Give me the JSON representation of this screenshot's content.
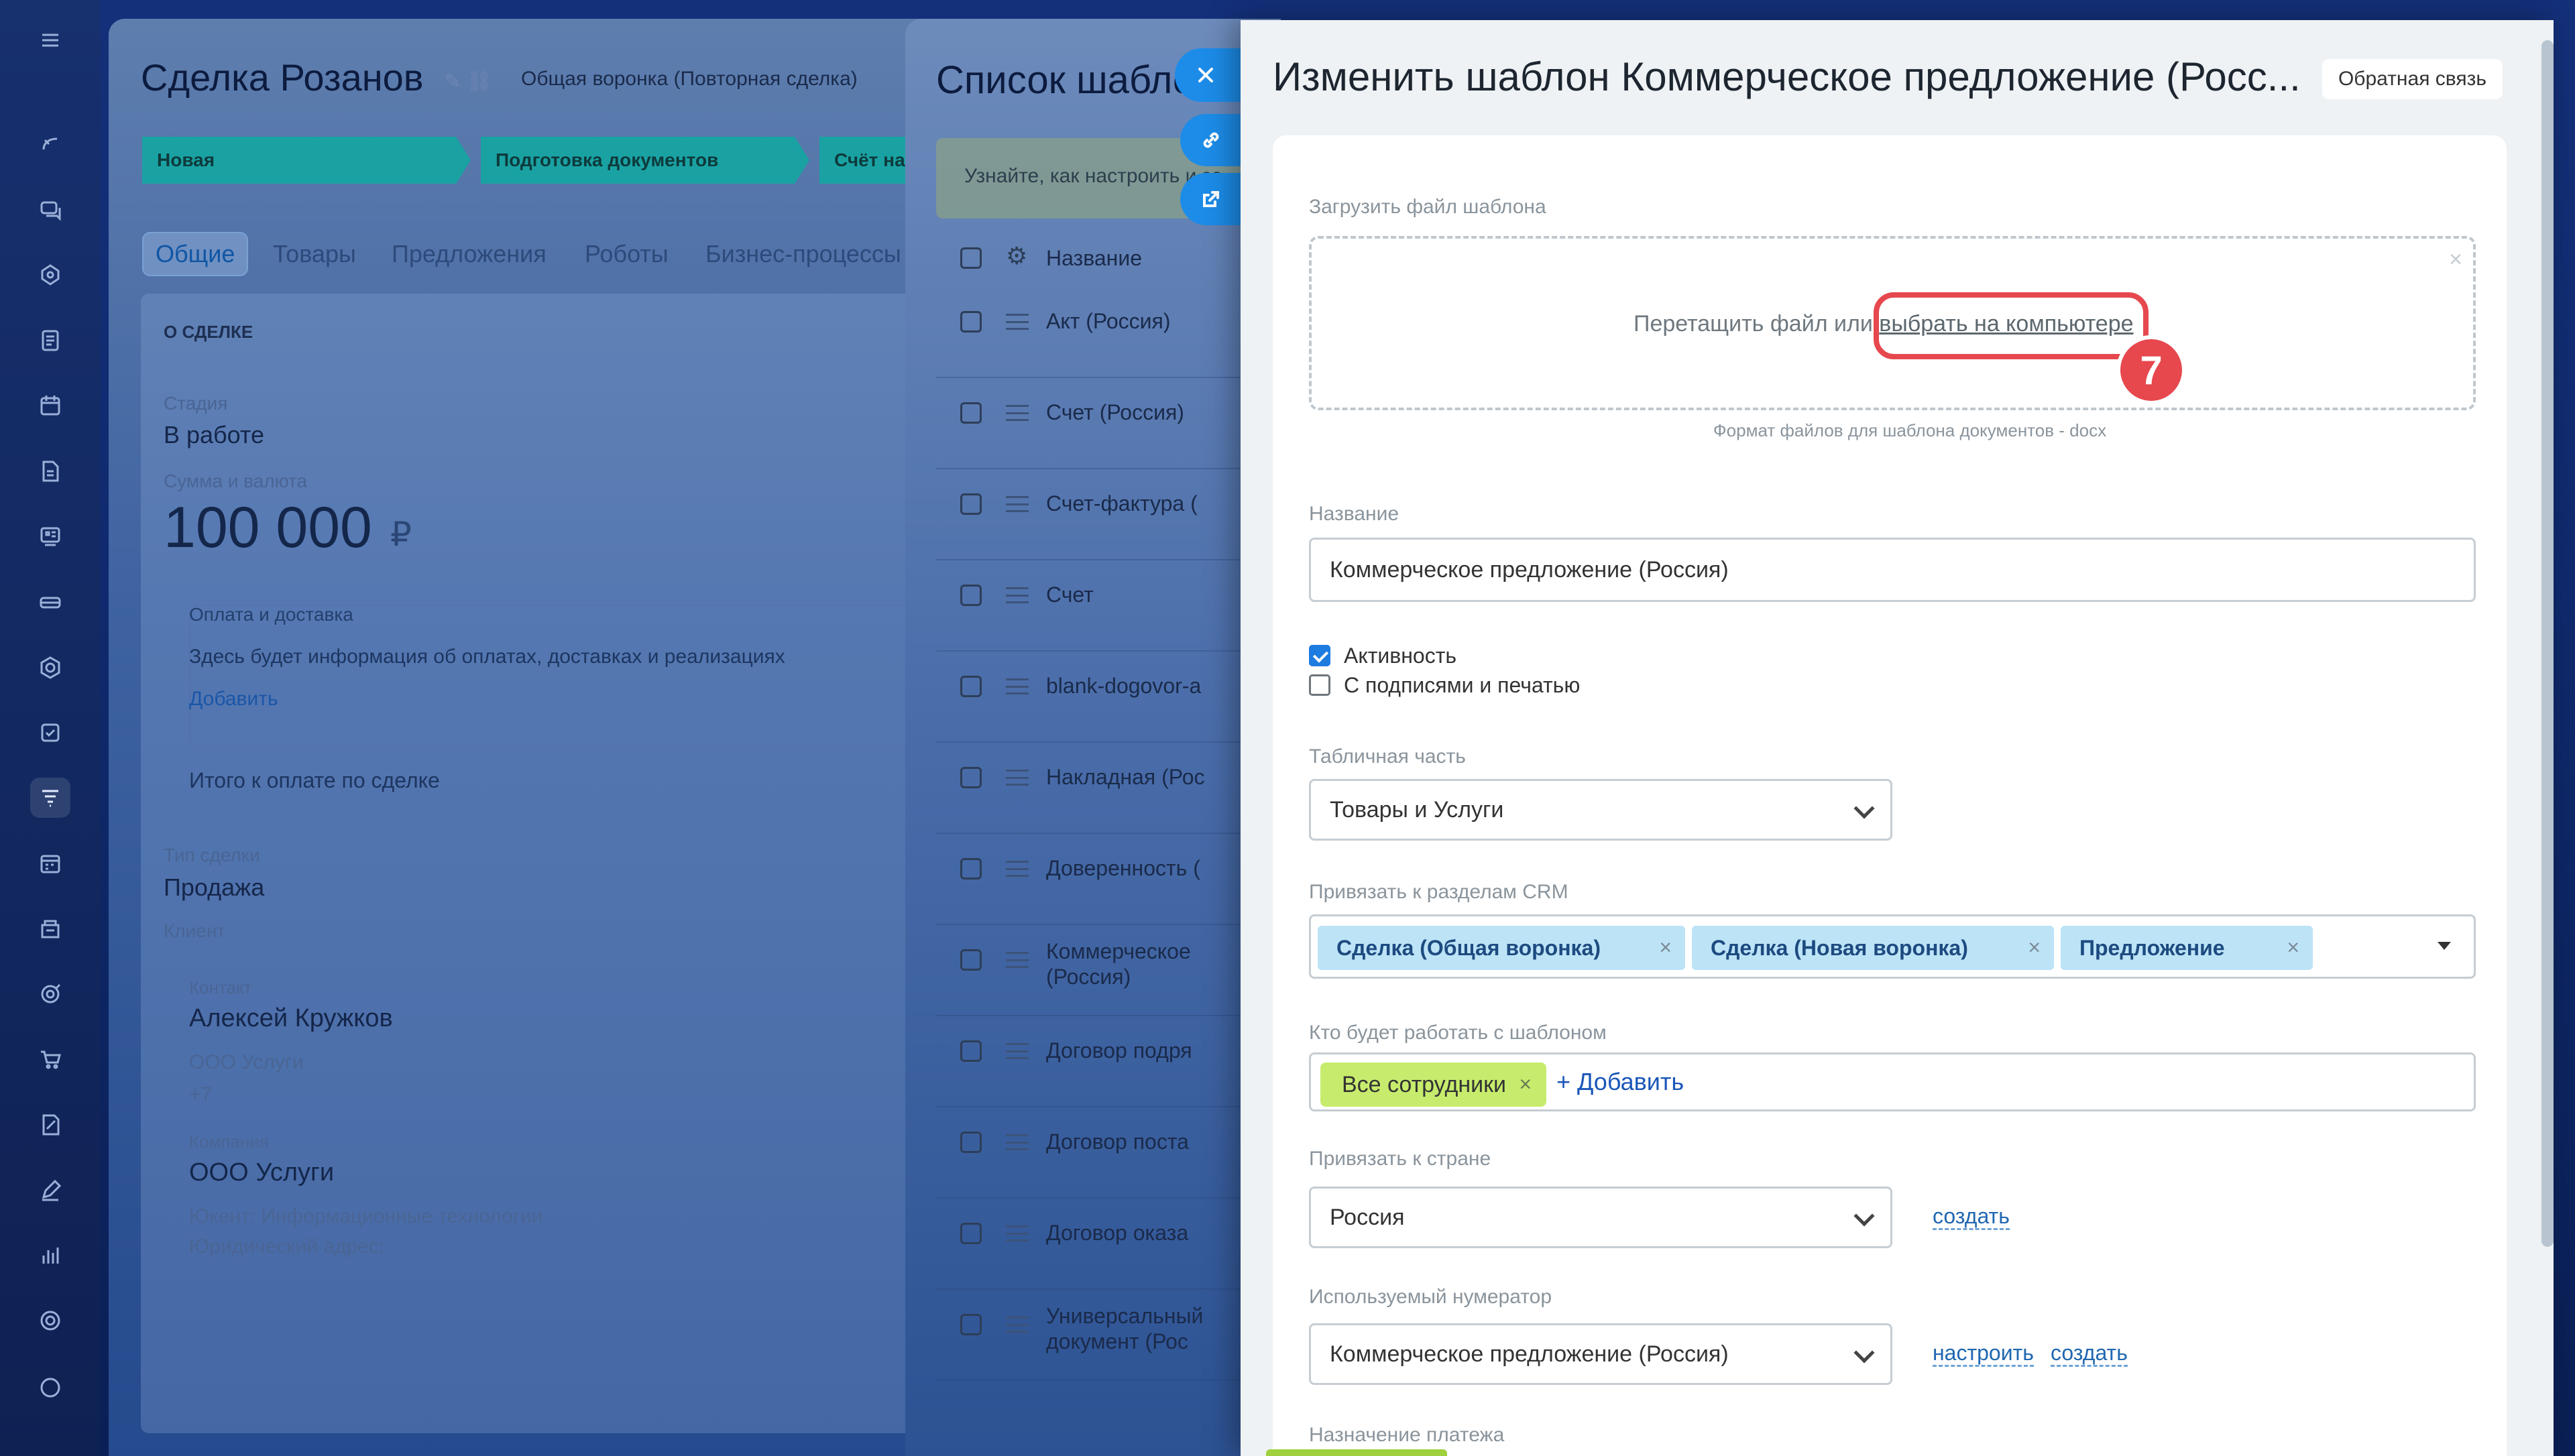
{
  "deal": {
    "title": "Сделка Розанов",
    "funnel": "Общая воронка (Повторная сделка)",
    "stages": [
      "Новая",
      "Подготовка документов",
      "Счёт на"
    ],
    "tabs": [
      "Общие",
      "Товары",
      "Предложения",
      "Роботы",
      "Бизнес-процессы"
    ],
    "section_title": "О СДЕЛКЕ",
    "stage_label": "Стадия",
    "stage_value": "В работе",
    "sum_label": "Сумма и валюта",
    "sum_value": "100 000",
    "currency": "₽",
    "payment_title": "Оплата и доставка",
    "payment_text": "Здесь будет информация об оплатах, доставках и реализациях",
    "payment_add": "Добавить",
    "total_label": "Итого к оплате по сделке",
    "type_label": "Тип сделки",
    "type_value": "Продажа",
    "client_label": "Клиент",
    "contact_label": "Контакт",
    "contact_name": "Алексей Кружков",
    "contact_company": "ООО Услуги",
    "contact_phone": "+7",
    "company_label": "Компания",
    "company_name": "ООО Услуги",
    "company_segment": "Юкент: Информационные технологии",
    "company_address": "Юридический адрес:"
  },
  "template_list": {
    "title": "Список шаблонов",
    "hint": "Узнайте, как настроить и за",
    "column_name": "Название",
    "rows": [
      "Акт (Россия)",
      "Счет (Россия)",
      "Счет-фактура (",
      "Счет",
      "blank-dogovor-a",
      "Накладная (Рос",
      "Доверенность (",
      "Коммерческое\n(Россия)",
      "Договор подря",
      "Договор поста",
      "Договор оказа",
      "Универсальный\nдокумент (Рос"
    ]
  },
  "panel": {
    "title": "Изменить шаблон Коммерческое предложение (Росс...",
    "feedback": "Обратная связь",
    "upload_label": "Загрузить файл шаблона",
    "dropzone_text": "Перетащить файл или ",
    "dropzone_link": "выбрать на компьютере",
    "dropzone_hint": "Формат файлов для шаблона документов - docx",
    "step_number": "7",
    "name_label": "Название",
    "name_value": "Коммерческое предложение (Россия)",
    "active_label": "Активность",
    "active_checked": true,
    "signatures_label": "С подписями и печатью",
    "signatures_checked": false,
    "table_label": "Табличная часть",
    "table_value": "Товары и Услуги",
    "crm_label": "Привязать к разделам CRM",
    "crm_tags": [
      "Сделка (Общая воронка)",
      "Сделка (Новая воронка)",
      "Предложение"
    ],
    "users_label": "Кто будет работать с шаблоном",
    "users_tag": "Все сотрудники",
    "users_add": "+ Добавить",
    "country_label": "Привязать к стране",
    "country_value": "Россия",
    "country_create": "создать",
    "numerator_label": "Используемый нумератор",
    "numerator_value": "Коммерческое предложение (Россия)",
    "numerator_configure": "настроить",
    "numerator_create": "создать",
    "payment_label": "Назначение платежа"
  },
  "colors": {
    "accent": "#1e7be0",
    "highlight": "#e6484e",
    "user_tag": "#c7ec6d",
    "crm_tag": "#bde3f7",
    "stage": "#1aa2a3"
  }
}
